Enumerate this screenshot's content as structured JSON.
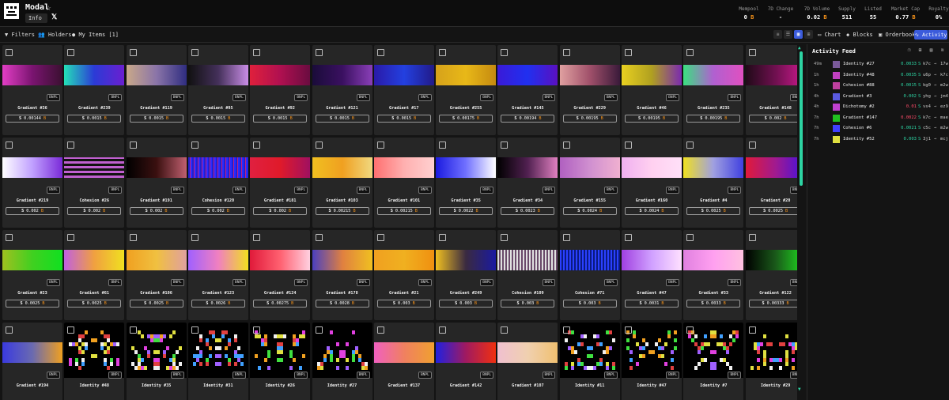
{
  "app": {
    "title": "Modal",
    "info_label": "Info"
  },
  "stats": [
    {
      "label": "Mempool",
      "value": "0",
      "unit": "B"
    },
    {
      "label": "7D Change",
      "value": "-",
      "unit": ""
    },
    {
      "label": "7D Volume",
      "value": "0.02",
      "unit": "B"
    },
    {
      "label": "Supply",
      "value": "511",
      "unit": ""
    },
    {
      "label": "Listed",
      "value": "55",
      "unit": ""
    },
    {
      "label": "Market Cap",
      "value": "0.77",
      "unit": "B"
    },
    {
      "label": "Royalty",
      "value": "0%",
      "unit": ""
    }
  ],
  "toolbar": {
    "filters": "Filters",
    "holders": "Holders",
    "my_items": "My Items [1]",
    "chart": "Chart",
    "blocks": "Blocks",
    "orderbook": "Orderbook",
    "activity": "Activity"
  },
  "currency": "B",
  "bnpl": "BNPL",
  "cards": [
    {
      "name": "Gradient #36",
      "price": "0.00144",
      "bg": "linear-gradient(90deg,#e23ec5,#7a1470,#3a1030)"
    },
    {
      "name": "Gradient #239",
      "price": "0.0015",
      "bg": "linear-gradient(90deg,#24e0b8,#2b3bd6,#6a1fd0)"
    },
    {
      "name": "Gradient #119",
      "price": "0.0015",
      "bg": "linear-gradient(90deg,#c9a889,#8a74a8,#2f2d80)"
    },
    {
      "name": "Gradient #95",
      "price": "0.0015",
      "bg": "linear-gradient(90deg,#111,#44305a,#c98de6)"
    },
    {
      "name": "Gradient #92",
      "price": "0.0015",
      "bg": "linear-gradient(90deg,#e0203c,#b01050,#6a0c40)"
    },
    {
      "name": "Gradient #121",
      "price": "0.0015",
      "bg": "linear-gradient(90deg,#1a0c3a,#3a1060,#8a3fb8)"
    },
    {
      "name": "Gradient #17",
      "price": "0.0015",
      "bg": "linear-gradient(90deg,#2a1aa8,#2340e0,#221a88)"
    },
    {
      "name": "Gradient #255",
      "price": "0.00175",
      "bg": "linear-gradient(90deg,#d6a21a,#e8b818,#c58a10)"
    },
    {
      "name": "Gradient #145",
      "price": "0.00194",
      "bg": "linear-gradient(90deg,#3a1ad8,#2030f0,#5a10c0)"
    },
    {
      "name": "Gradient #229",
      "price": "0.00195",
      "bg": "linear-gradient(90deg,#e0a0a0,#a0506a,#3a1a3a)"
    },
    {
      "name": "Gradient #46",
      "price": "0.00195",
      "bg": "linear-gradient(90deg,#e8d020,#b0a020,#7a2ab0)"
    },
    {
      "name": "Gradient #235",
      "price": "0.00195",
      "bg": "linear-gradient(90deg,#3ae080,#b060d0,#e050c0)"
    },
    {
      "name": "Gradient #148",
      "price": "0.002",
      "bg": "linear-gradient(90deg,#200a18,#701050,#d01a90)"
    },
    {
      "name": "Gradient #219",
      "price": "0.002",
      "bg": "linear-gradient(90deg,#ffffff,#c0a0ff,#7a2ad8)"
    },
    {
      "name": "Cohesion #26",
      "price": "0.002",
      "bg": "repeating-linear-gradient(0deg,#c060d0 0 3px,#111 3px 6px)"
    },
    {
      "name": "Gradient #191",
      "price": "0.002",
      "bg": "linear-gradient(90deg,#000,#3a1010,#c06070)"
    },
    {
      "name": "Cohesion #120",
      "price": "0.002",
      "bg": "repeating-linear-gradient(90deg,#2020d0 0 2px,#c02080 2px 3px,#2a2aff 3px 5px)"
    },
    {
      "name": "Gradient #181",
      "price": "0.002",
      "bg": "linear-gradient(90deg,#e02040,#e01a2a,#a01060)"
    },
    {
      "name": "Gradient #103",
      "price": "0.00215",
      "bg": "linear-gradient(90deg,#f0c020,#f0a020,#f0d880)"
    },
    {
      "name": "Gradient #101",
      "price": "0.00215",
      "bg": "linear-gradient(90deg,#ff7070,#ffb0b0,#ffd0d0)"
    },
    {
      "name": "Gradient #35",
      "price": "0.0022",
      "bg": "linear-gradient(90deg,#1a1ae0,#7070ff,#ffffff)"
    },
    {
      "name": "Gradient #34",
      "price": "0.0023",
      "bg": "linear-gradient(90deg,#000,#502050,#e080c0)"
    },
    {
      "name": "Gradient #155",
      "price": "0.0024",
      "bg": "linear-gradient(90deg,#b060c0,#d090d0,#f0b0d0)"
    },
    {
      "name": "Gradient #160",
      "price": "0.0024",
      "bg": "linear-gradient(90deg,#f0b0f0,#ffd0f0,#ffe0f8)"
    },
    {
      "name": "Gradient #4",
      "price": "0.0025",
      "bg": "linear-gradient(90deg,#f0e020,#a0a0e0,#4040e0)"
    },
    {
      "name": "Gradient #20",
      "price": "0.0025",
      "bg": "linear-gradient(90deg,#e01a3a,#a01a90,#4010e0)"
    },
    {
      "name": "Gradient #23",
      "price": "0.0025",
      "bg": "linear-gradient(90deg,#a0c020,#40d020,#10e020)"
    },
    {
      "name": "Gradient #61",
      "price": "0.0025",
      "bg": "linear-gradient(90deg,#c060e0,#f0a040,#f0e020)"
    },
    {
      "name": "Gradient #106",
      "price": "0.0025",
      "bg": "linear-gradient(90deg,#f0a020,#f0c040,#e0a0a0)"
    },
    {
      "name": "Gradient #123",
      "price": "0.0026",
      "bg": "linear-gradient(90deg,#a060ff,#f080c0,#f0e020)"
    },
    {
      "name": "Gradient #124",
      "price": "0.00275",
      "bg": "linear-gradient(90deg,#e01a3a,#ff6070,#ffd0e0)"
    },
    {
      "name": "Gradient #178",
      "price": "0.0028",
      "bg": "linear-gradient(90deg,#4a40c0,#e08040,#f0c020)"
    },
    {
      "name": "Gradient #21",
      "price": "0.003",
      "bg": "linear-gradient(90deg,#f0a020,#f0b020,#f09010)"
    },
    {
      "name": "Gradient #249",
      "price": "0.003",
      "bg": "linear-gradient(90deg,#f0c020,#3a2a40,#1a1aa0)"
    },
    {
      "name": "Cohesion #109",
      "price": "0.003",
      "bg": "repeating-linear-gradient(90deg,#e0e0e0 0 2px,#6a4a6a 2px 4px)"
    },
    {
      "name": "Cohesion #71",
      "price": "0.003",
      "bg": "repeating-linear-gradient(90deg,#2a40ff 0 2px,#0a1a80 2px 4px)"
    },
    {
      "name": "Gradient #47",
      "price": "0.0031",
      "bg": "linear-gradient(90deg,#a040e0,#d0a0ff,#ffe0ff)"
    },
    {
      "name": "Gradient #33",
      "price": "0.0033",
      "bg": "linear-gradient(90deg,#e080e0,#ffa0f0,#ffc0e0)"
    },
    {
      "name": "Gradient #122",
      "price": "0.00333",
      "bg": "linear-gradient(90deg,#000,#1a5a1a,#20e020)"
    },
    {
      "name": "Gradient #194",
      "price": "",
      "bg": "linear-gradient(90deg,#3a3ae0,#6a6ab0,#f0a020)"
    },
    {
      "name": "Identity #48",
      "price": "",
      "bg": "#000"
    },
    {
      "name": "Identity #35",
      "price": "",
      "bg": "#000"
    },
    {
      "name": "Identity #31",
      "price": "",
      "bg": "#000"
    },
    {
      "name": "Identity #26",
      "price": "",
      "bg": "#000"
    },
    {
      "name": "Identity #27",
      "price": "",
      "bg": "#000"
    },
    {
      "name": "Gradient #137",
      "price": "",
      "bg": "linear-gradient(90deg,#f060c0,#f08060,#f0a030)"
    },
    {
      "name": "Gradient #142",
      "price": "",
      "bg": "linear-gradient(90deg,#2020e0,#a01a60,#f03010)"
    },
    {
      "name": "Gradient #107",
      "price": "",
      "bg": "linear-gradient(90deg,#f0c0d0,#f0d0b0,#f0c070)"
    },
    {
      "name": "Identity #11",
      "price": "",
      "bg": "#000"
    },
    {
      "name": "Identity #47",
      "price": "",
      "bg": "#000"
    },
    {
      "name": "Identity #7",
      "price": "",
      "bg": "#000"
    },
    {
      "name": "Identity #29",
      "price": "",
      "bg": "#000"
    }
  ],
  "feed": {
    "title": "Activity Feed",
    "rows": [
      {
        "time": "49m",
        "name": "Identity #27",
        "price": "0.0033",
        "from": "k7c",
        "to": "17w",
        "up": true,
        "thumb": "#7a5a9a"
      },
      {
        "time": "1h",
        "name": "Identity #48",
        "price": "0.0035",
        "from": "u6p",
        "to": "k7c",
        "up": true,
        "thumb": "#c040c0"
      },
      {
        "time": "1h",
        "name": "Cohesion #88",
        "price": "0.0015",
        "from": "kg0",
        "to": "m2w",
        "up": true,
        "thumb": "#c040a0"
      },
      {
        "time": "4h",
        "name": "Gradient #3",
        "price": "0.002",
        "from": "yhg",
        "to": "jm4",
        "up": true,
        "thumb": "#5a5ae0"
      },
      {
        "time": "4h",
        "name": "Dichotomy #2",
        "price": "0.01",
        "from": "vs4",
        "to": "ez9",
        "up": false,
        "thumb": "#c040d0"
      },
      {
        "time": "7h",
        "name": "Gradient #147",
        "price": "0.0022",
        "from": "k7c",
        "to": "mae",
        "up": false,
        "thumb": "#20c020"
      },
      {
        "time": "7h",
        "name": "Cohesion #6",
        "price": "0.0021",
        "from": "c5c",
        "to": "m2w",
        "up": true,
        "thumb": "#4040ff"
      },
      {
        "time": "7h",
        "name": "Identity #52",
        "price": "0.003",
        "from": "3j1",
        "to": "mcj",
        "up": true,
        "thumb": "#e0e040"
      }
    ]
  }
}
